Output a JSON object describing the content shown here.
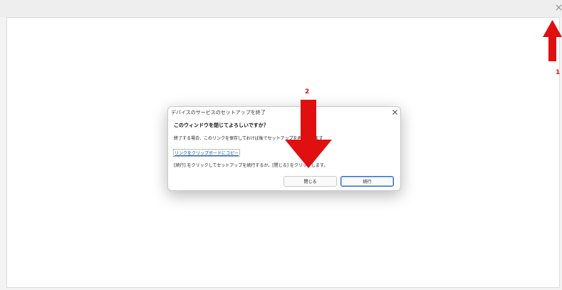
{
  "dialog": {
    "title": "デバイスのサービスのセットアップを終了",
    "heading": "このウィンドウを閉じてよろしいですか？",
    "body": "終了する場合、このリンクを保存しておけば後でセットアップを再開できます",
    "link": "リンクをクリップボードにコピー",
    "note": "[続行] をクリックしてセットアップを続行するか、[閉じる] をクリックします。",
    "buttons": {
      "close": "閉じる",
      "continue": "続行"
    }
  },
  "annotations": {
    "label1": "1",
    "label2": "2",
    "color": "#e01010"
  },
  "icons": {
    "window_close": "close-icon",
    "dialog_close": "close-icon",
    "arrow": "arrow-icon"
  }
}
